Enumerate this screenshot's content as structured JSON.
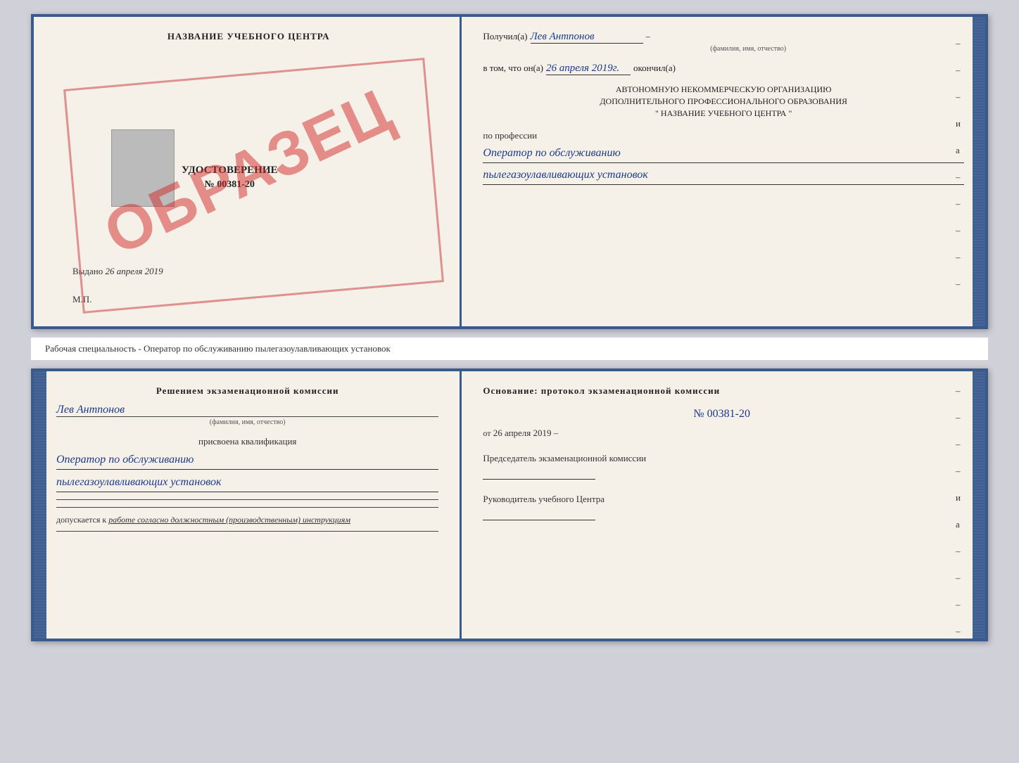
{
  "page": {
    "background": "#d0d0d8"
  },
  "top_cert": {
    "left": {
      "org_title": "НАЗВАНИЕ УЧЕБНОГО ЦЕНТРА",
      "watermark": "ОБРАЗЕЦ",
      "doc_title": "УДОСТОВЕРЕНИЕ",
      "doc_number": "№ 00381-20",
      "issued_label": "Выдано",
      "issued_date": "26 апреля 2019",
      "mp_label": "М.П."
    },
    "right": {
      "received_label": "Получил(а)",
      "recipient_name": "Лев Антпонов",
      "name_sublabel": "(фамилия, имя, отчество)",
      "completed_prefix": "в том, что он(а)",
      "completed_date": "26 апреля 2019г.",
      "completed_suffix": "окончил(а)",
      "org_line1": "АВТОНОМНУЮ НЕКОММЕРЧЕСКУЮ ОРГАНИЗАЦИЮ",
      "org_line2": "ДОПОЛНИТЕЛЬНОГО ПРОФЕССИОНАЛЬНОГО ОБРАЗОВАНИЯ",
      "org_line3": "\"    НАЗВАНИЕ УЧЕБНОГО ЦЕНТРА    \"",
      "profession_label": "по профессии",
      "profession_line1": "Оператор по обслуживанию",
      "profession_line2": "пылегазоулавливающих установок",
      "aside_dashes": [
        "-",
        "-",
        "-",
        "и",
        "а",
        "-",
        "-",
        "-",
        "-",
        "-"
      ]
    }
  },
  "middle_strip": {
    "text": "Рабочая специальность - Оператор по обслуживанию пылегазоулавливающих установок"
  },
  "bottom_cert": {
    "left": {
      "commission_title": "Решением экзаменационной комиссии",
      "person_name": "Лев Антпонов",
      "name_sublabel": "(фамилия, имя, отчество)",
      "qualification_label": "присвоена квалификация",
      "qual_line1": "Оператор по обслуживанию",
      "qual_line2": "пылегазоулавливающих установок",
      "footer_label": "допускается к",
      "footer_italic": "работе согласно должностным (производственным) инструкциям"
    },
    "right": {
      "basis_label": "Основание: протокол экзаменационной комиссии",
      "protocol_number": "№  00381-20",
      "date_prefix": "от",
      "date_value": "26 апреля 2019",
      "chairman_label": "Председатель экзаменационной комиссии",
      "director_label": "Руководитель учебного Центра",
      "aside_dashes": [
        "-",
        "-",
        "-",
        "-",
        "и",
        "а",
        "-",
        "-",
        "-",
        "-"
      ]
    }
  }
}
